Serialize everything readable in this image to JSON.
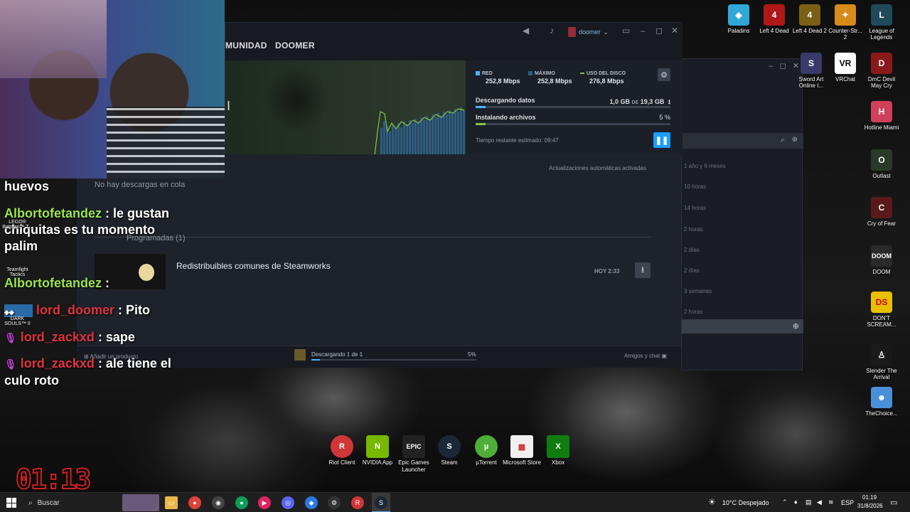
{
  "steam": {
    "nav": {
      "community": "MUNIDAD",
      "user_tab": "DOOMER"
    },
    "username": "doomer",
    "stats": {
      "red_label": "RED",
      "red_value": "252,8 Mbps",
      "max_label": "MÁXIMO",
      "max_value": "252,8 Mbps",
      "disk_label": "USO DEL DISCO",
      "disk_value": "276,8 Mbps"
    },
    "download": {
      "label": "Descargando datos",
      "progress_text": "1,0 GB",
      "of": "DE",
      "total": "19,3 GB",
      "progress": 0.05
    },
    "install": {
      "label": "Instalando archivos",
      "percent": "5 %",
      "progress": 0.05
    },
    "eta": "Tiempo restante estimado: 09:47",
    "auto_updates": "Actualizaciones automáticas activadas",
    "queue_empty": "No hay descargas en cola",
    "scheduled_section": "Programadas (1)",
    "item": {
      "title": "Redistribuibles comunes de Steamworks",
      "time": "HOY 2:33"
    },
    "footer": {
      "add_product": "Añadir un producto",
      "status": "Descargando 1 de 1",
      "percent": "5%",
      "friends": "Amigos y chat"
    }
  },
  "friends_window": {
    "entries": [
      "1 año y 6 meses",
      "10 horas",
      "14 horas",
      "2 horas",
      "2 días",
      "2 días",
      "3 semanas",
      "2 horas"
    ]
  },
  "chat": [
    {
      "user": "",
      "message": "huevos"
    },
    {
      "user": "Albortofetandez",
      "message": " : le gustan chiquitas es tu momento palim"
    },
    {
      "user": "Albortofetandez",
      "message": " :"
    },
    {
      "user": "lord_doomer",
      "message": " : Pito"
    },
    {
      "user": "lord_zackxd",
      "message": " : sape"
    },
    {
      "user": "lord_zackxd",
      "message": " : ale tiene el culo roto"
    }
  ],
  "left_desktop_labels": [
    "LEGO® Batman™ T...",
    "Teamfight Tactics",
    "DARK SOULS™ II"
  ],
  "overlay_clock": "01:13",
  "desktop_icons_right": [
    {
      "name": "Paladins",
      "color": "#2fa8d8"
    },
    {
      "name": "Left 4 Dead",
      "color": "#b01818"
    },
    {
      "name": "Left 4 Dead 2",
      "color": "#7a5f14"
    },
    {
      "name": "Counter-Str... 2",
      "color": "#d88a1a"
    },
    {
      "name": "League of Legends",
      "color": "#1f4a5a"
    },
    {
      "name": "Sword Art Online I...",
      "color": "#3a3a6a"
    },
    {
      "name": "VRChat",
      "color": "#ffffff"
    },
    {
      "name": "DmC Devil May Cry",
      "color": "#8a1a1a"
    },
    {
      "name": "Hotline Miami",
      "color": "#d0405a"
    },
    {
      "name": "Outlast",
      "color": "#2a3a2a"
    },
    {
      "name": "Cry of Fear",
      "color": "#5a1a1a"
    },
    {
      "name": "DOOM",
      "color": "#2a2a2a"
    },
    {
      "name": "DON'T SCREAM...",
      "color": "#e8c000"
    },
    {
      "name": "Slender The Arrival",
      "color": "#1a1a1a"
    },
    {
      "name": "TheChoice...",
      "color": "#4a90d9"
    }
  ],
  "desktop_icons_bottom": [
    {
      "name": "Riot Client",
      "color": "#d13639",
      "glyph": "R"
    },
    {
      "name": "NVIDIA App",
      "color": "#76b900",
      "glyph": "N"
    },
    {
      "name": "Epic Games Launcher",
      "color": "#222222",
      "glyph": "EPIC"
    },
    {
      "name": "Steam",
      "color": "#1b2838",
      "glyph": "S"
    },
    {
      "name": "µTorrent",
      "color": "#4fae37",
      "glyph": "µ"
    },
    {
      "name": "Microsoft Store",
      "color": "#f0f0f0",
      "glyph": "▦"
    },
    {
      "name": "Xbox",
      "color": "#107c10",
      "glyph": "X"
    }
  ],
  "taskbar": {
    "search_placeholder": "Buscar",
    "weather": "10°C  Despejado",
    "language": "ESP",
    "time": "01:19",
    "date": "31/8/2026"
  },
  "colors": {
    "steam_blue": "#1a9fff",
    "chat_green": "#9be34e",
    "chat_red": "#e0343c"
  }
}
